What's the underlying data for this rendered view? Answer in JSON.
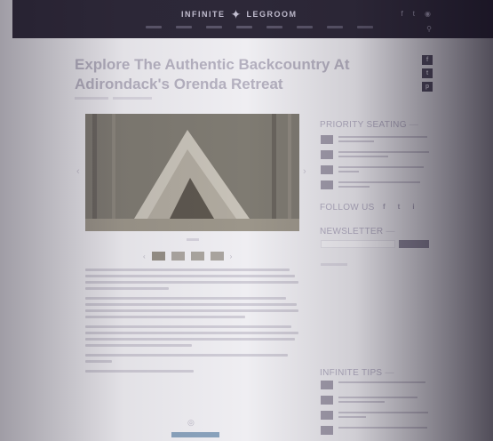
{
  "header": {
    "logo_left": "INFINITE",
    "logo_right": "LEGROOM",
    "social_icons": [
      "facebook-icon",
      "twitter-icon",
      "instagram-icon"
    ],
    "search_icon": "search-icon"
  },
  "article": {
    "title": "Explore The Authentic Backcountry At Adirondack's Orenda Retreat",
    "share_icons": [
      "f",
      "t",
      "p"
    ]
  },
  "sidebar": {
    "priority_heading": "PRIORITY SEATING",
    "follow_heading": "FOLLOW US",
    "follow_icons": [
      "f",
      "t",
      "i"
    ],
    "newsletter_heading": "NEWSLETTER",
    "tips_heading": "INFINITE TIPS"
  },
  "colors": {
    "header_bg": "#2d2838",
    "accent": "#8f8a9c",
    "promo": "#8aa3bd"
  }
}
